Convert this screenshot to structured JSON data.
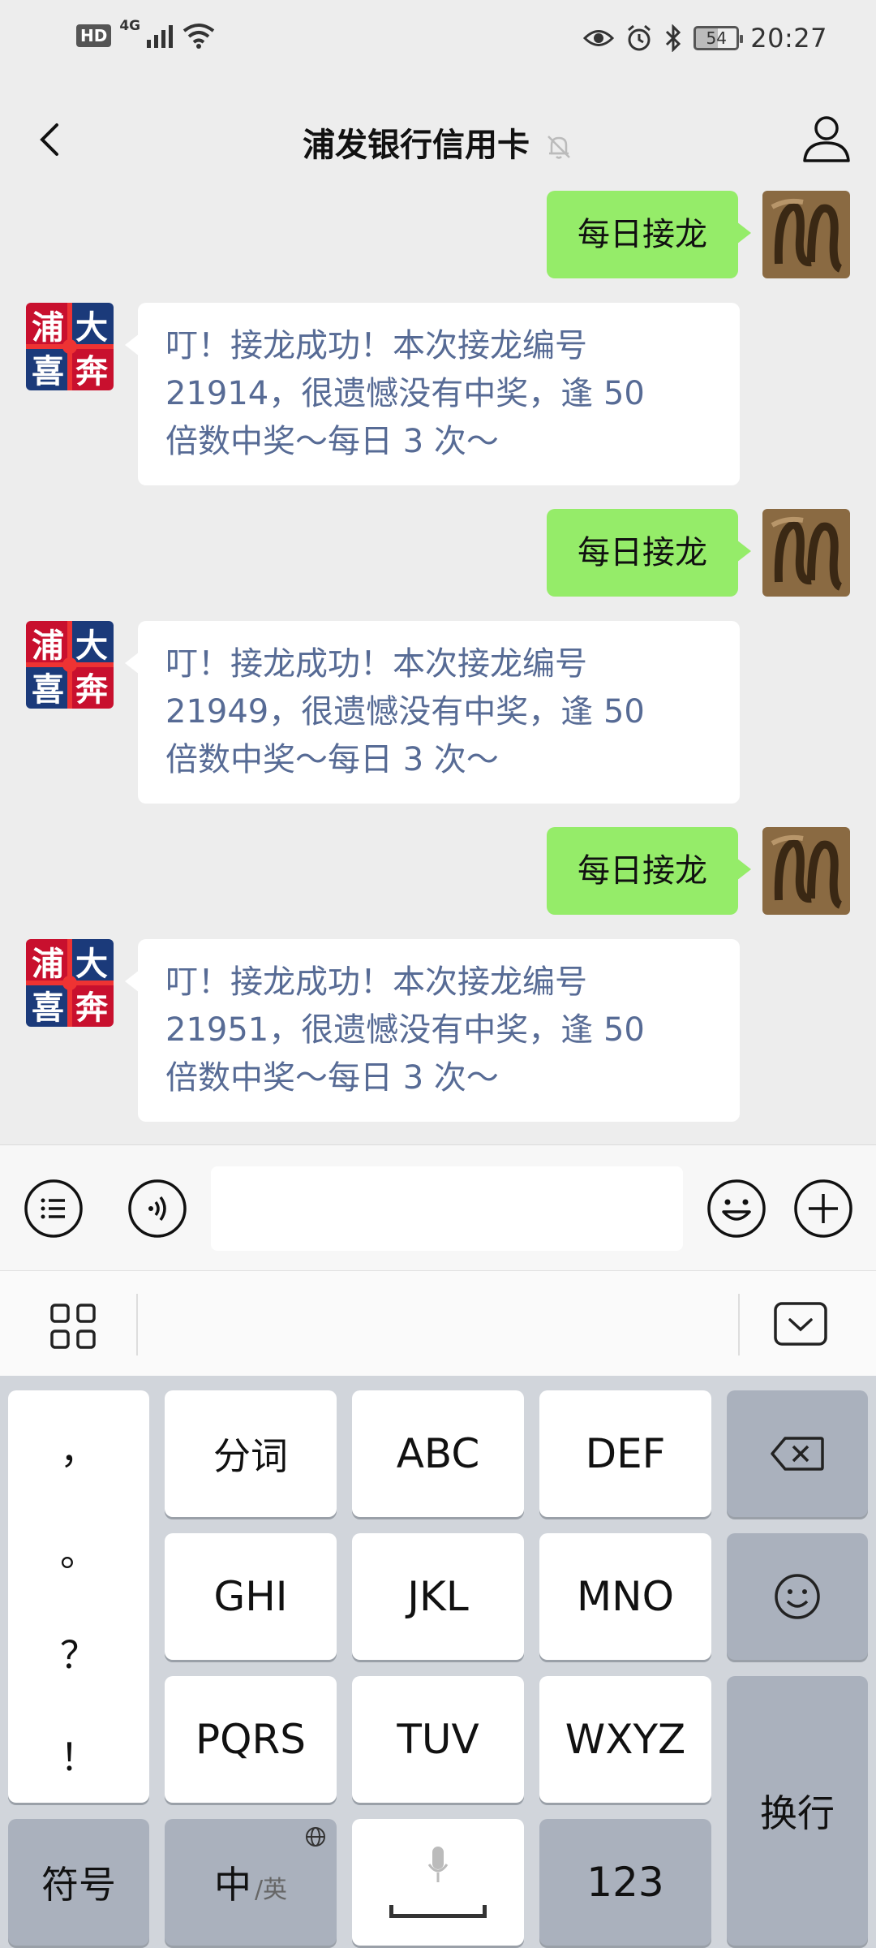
{
  "status_bar": {
    "hd": "HD",
    "network": "4G",
    "battery": "54",
    "time": "20:27"
  },
  "nav": {
    "title": "浦发银行信用卡",
    "back_icon": "chevron-left-icon",
    "mute_icon": "bell-off-icon",
    "profile_icon": "person-icon"
  },
  "messages": [
    {
      "from": "me",
      "text": "每日接龙"
    },
    {
      "from": "bank",
      "lines": [
        "叮！接龙成功！本次接龙编号",
        "21914，很遗憾没有中奖，逢 50",
        "倍数中奖～每日 3 次～"
      ]
    },
    {
      "from": "me",
      "text": "每日接龙"
    },
    {
      "from": "bank",
      "lines": [
        "叮！接龙成功！本次接龙编号",
        "21949，很遗憾没有中奖，逢 50",
        "倍数中奖～每日 3 次～"
      ]
    },
    {
      "from": "me",
      "text": "每日接龙"
    },
    {
      "from": "bank",
      "lines": [
        "叮！接龙成功！本次接龙编号",
        "21951，很遗憾没有中奖，逢 50",
        "倍数中奖～每日 3 次～"
      ]
    }
  ],
  "bank_avatar": {
    "chars": [
      "浦",
      "大",
      "喜",
      "奔"
    ]
  },
  "input": {
    "value": "",
    "menu_icon": "list-menu-icon",
    "voice_icon": "voice-icon",
    "emoji_icon": "emoji-icon",
    "plus_icon": "plus-icon"
  },
  "keyboard": {
    "punctuation": [
      "，",
      "。",
      "？",
      "！"
    ],
    "row1": [
      "分词",
      "ABC",
      "DEF"
    ],
    "row2": [
      "GHI",
      "JKL",
      "MNO"
    ],
    "row3": [
      "PQRS",
      "TUV",
      "WXYZ"
    ],
    "symbols": "符号",
    "zh": "中",
    "en": "/英",
    "num": "123",
    "enter": "换行"
  },
  "colors": {
    "green_bubble": "#95ec69",
    "link_text": "#576b95",
    "background": "#ededed"
  }
}
